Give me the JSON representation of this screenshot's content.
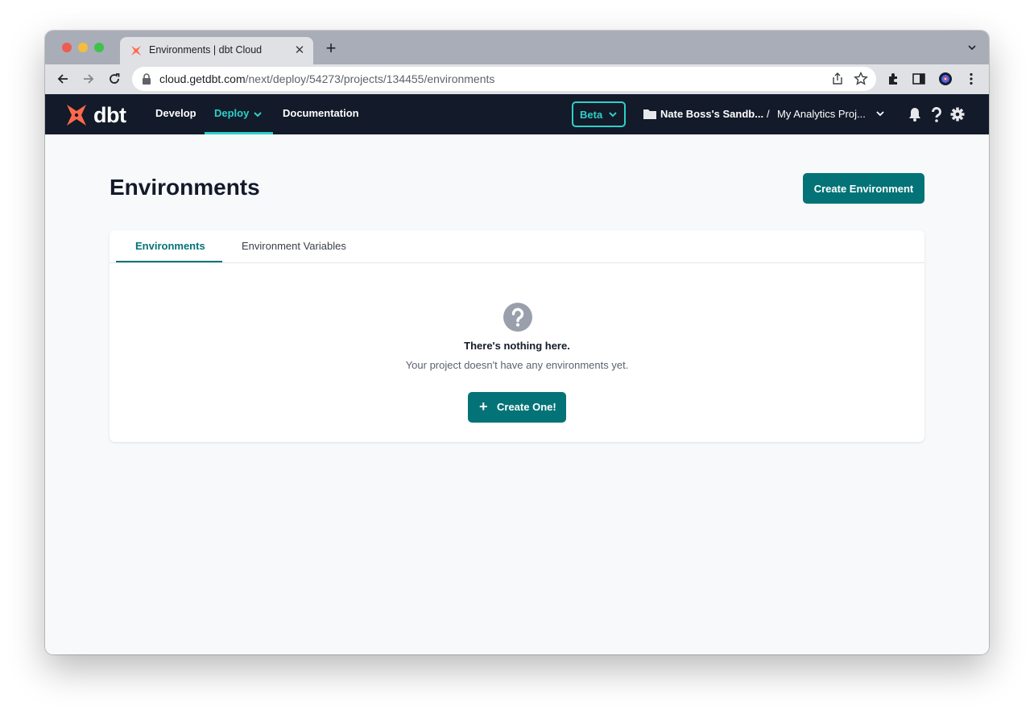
{
  "browser": {
    "tab_title": "Environments | dbt Cloud",
    "url_host": "cloud.getdbt.com",
    "url_path": "/next/deploy/54273/projects/134455/environments"
  },
  "nav": {
    "logo_text": "dbt",
    "develop": "Develop",
    "deploy": "Deploy",
    "documentation": "Documentation",
    "beta": "Beta",
    "org": "Nate Boss's Sandb...",
    "separator": "/",
    "project": "My Analytics Proj..."
  },
  "page": {
    "title": "Environments",
    "create_button": "Create Environment",
    "tabs": [
      {
        "label": "Environments",
        "active": true
      },
      {
        "label": "Environment Variables",
        "active": false
      }
    ],
    "empty": {
      "title": "There's nothing here.",
      "subtitle": "Your project doesn't have any environments yet.",
      "button": "Create One!"
    }
  },
  "colors": {
    "nav_bg": "#131a2a",
    "accent": "#2ed0c8",
    "primary": "#047377",
    "brand_orange": "#ff694a"
  }
}
